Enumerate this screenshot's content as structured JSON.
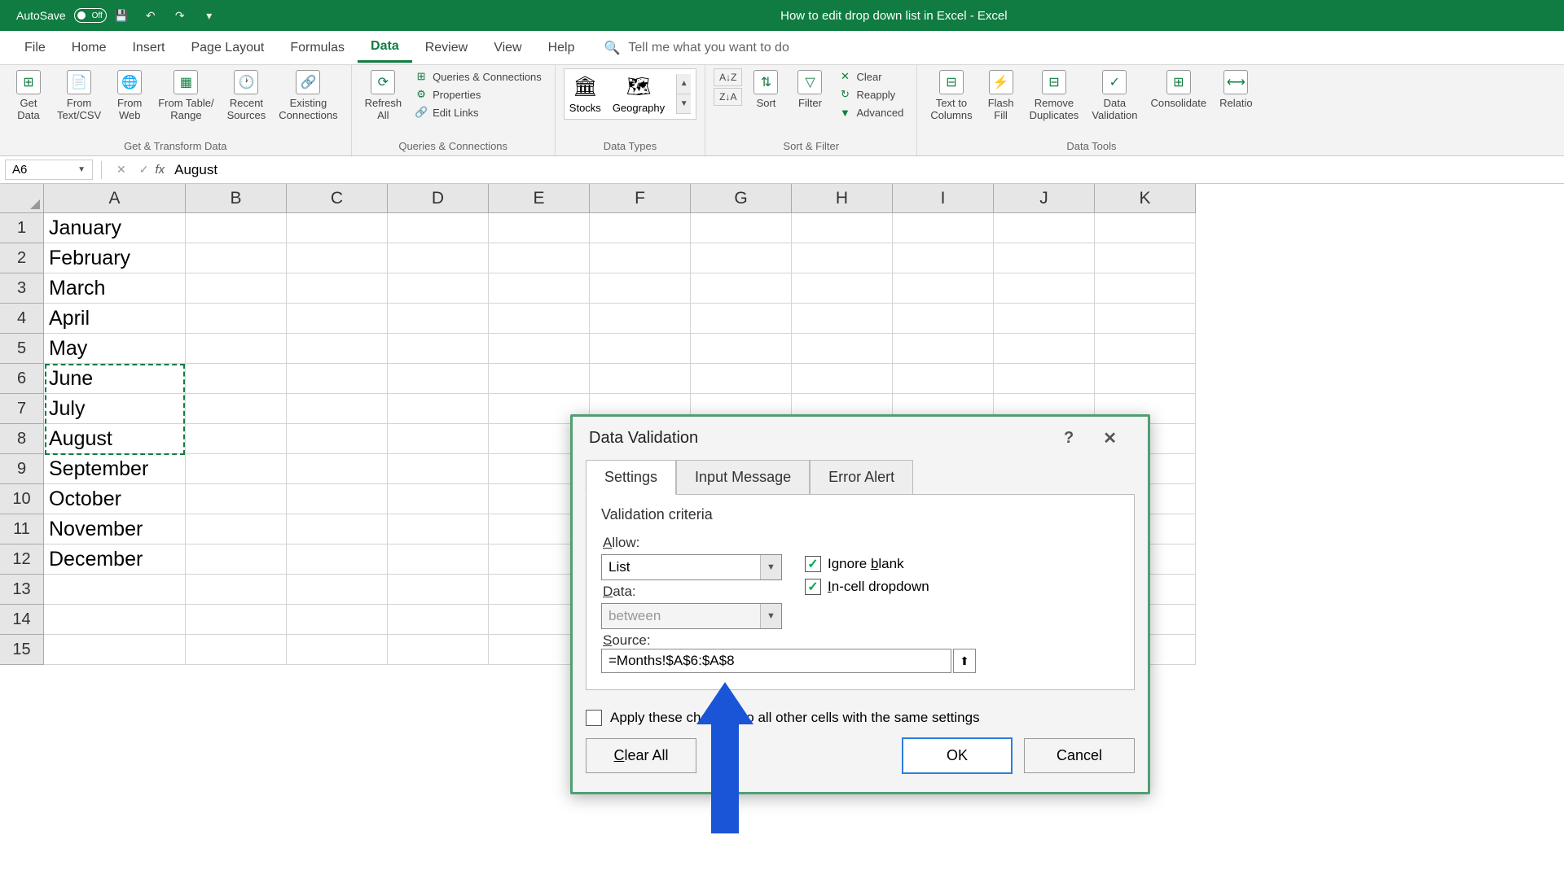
{
  "titlebar": {
    "autosave_label": "AutoSave",
    "autosave_state": "Off",
    "title": "How to edit drop down list in Excel  -  Excel"
  },
  "tabs": {
    "file": "File",
    "home": "Home",
    "insert": "Insert",
    "page_layout": "Page Layout",
    "formulas": "Formulas",
    "data": "Data",
    "review": "Review",
    "view": "View",
    "help": "Help",
    "tell_me": "Tell me what you want to do"
  },
  "ribbon": {
    "get_transform": {
      "label": "Get & Transform Data",
      "get_data": "Get\nData",
      "from_text": "From\nText/CSV",
      "from_web": "From\nWeb",
      "from_table": "From Table/\nRange",
      "recent": "Recent\nSources",
      "existing": "Existing\nConnections"
    },
    "queries": {
      "label": "Queries & Connections",
      "refresh": "Refresh\nAll",
      "conn": "Queries & Connections",
      "props": "Properties",
      "edit_links": "Edit Links"
    },
    "data_types": {
      "label": "Data Types",
      "stocks": "Stocks",
      "geo": "Geography"
    },
    "sort_filter": {
      "label": "Sort & Filter",
      "sort": "Sort",
      "filter": "Filter",
      "clear": "Clear",
      "reapply": "Reapply",
      "advanced": "Advanced"
    },
    "data_tools": {
      "label": "Data Tools",
      "ttc": "Text to\nColumns",
      "ff": "Flash\nFill",
      "rd": "Remove\nDuplicates",
      "dv": "Data\nValidation",
      "cons": "Consolidate",
      "rel": "Relatio"
    }
  },
  "formula_bar": {
    "name": "A6",
    "value": "August"
  },
  "columns": [
    "A",
    "B",
    "C",
    "D",
    "E",
    "F",
    "G",
    "H",
    "I",
    "J",
    "K"
  ],
  "rows": [
    {
      "n": "1",
      "a": "January"
    },
    {
      "n": "2",
      "a": "February"
    },
    {
      "n": "3",
      "a": "March"
    },
    {
      "n": "4",
      "a": "April"
    },
    {
      "n": "5",
      "a": "May"
    },
    {
      "n": "6",
      "a": "June"
    },
    {
      "n": "7",
      "a": "July"
    },
    {
      "n": "8",
      "a": "August"
    },
    {
      "n": "9",
      "a": "September"
    },
    {
      "n": "10",
      "a": "October"
    },
    {
      "n": "11",
      "a": "November"
    },
    {
      "n": "12",
      "a": "December"
    },
    {
      "n": "13",
      "a": ""
    },
    {
      "n": "14",
      "a": ""
    },
    {
      "n": "15",
      "a": ""
    }
  ],
  "dialog": {
    "title": "Data Validation",
    "tab_settings": "Settings",
    "tab_input": "Input Message",
    "tab_error": "Error Alert",
    "criteria": "Validation criteria",
    "allow_label": "Allow:",
    "allow_value": "List",
    "ignore_blank": "Ignore blank",
    "incell": "In-cell dropdown",
    "data_label": "Data:",
    "data_value": "between",
    "source_label": "Source:",
    "source_value": "=Months!$A$6:$A$8",
    "apply_label": "Apply these changes to all other cells with the same settings",
    "clear": "Clear All",
    "ok": "OK",
    "cancel": "Cancel"
  }
}
